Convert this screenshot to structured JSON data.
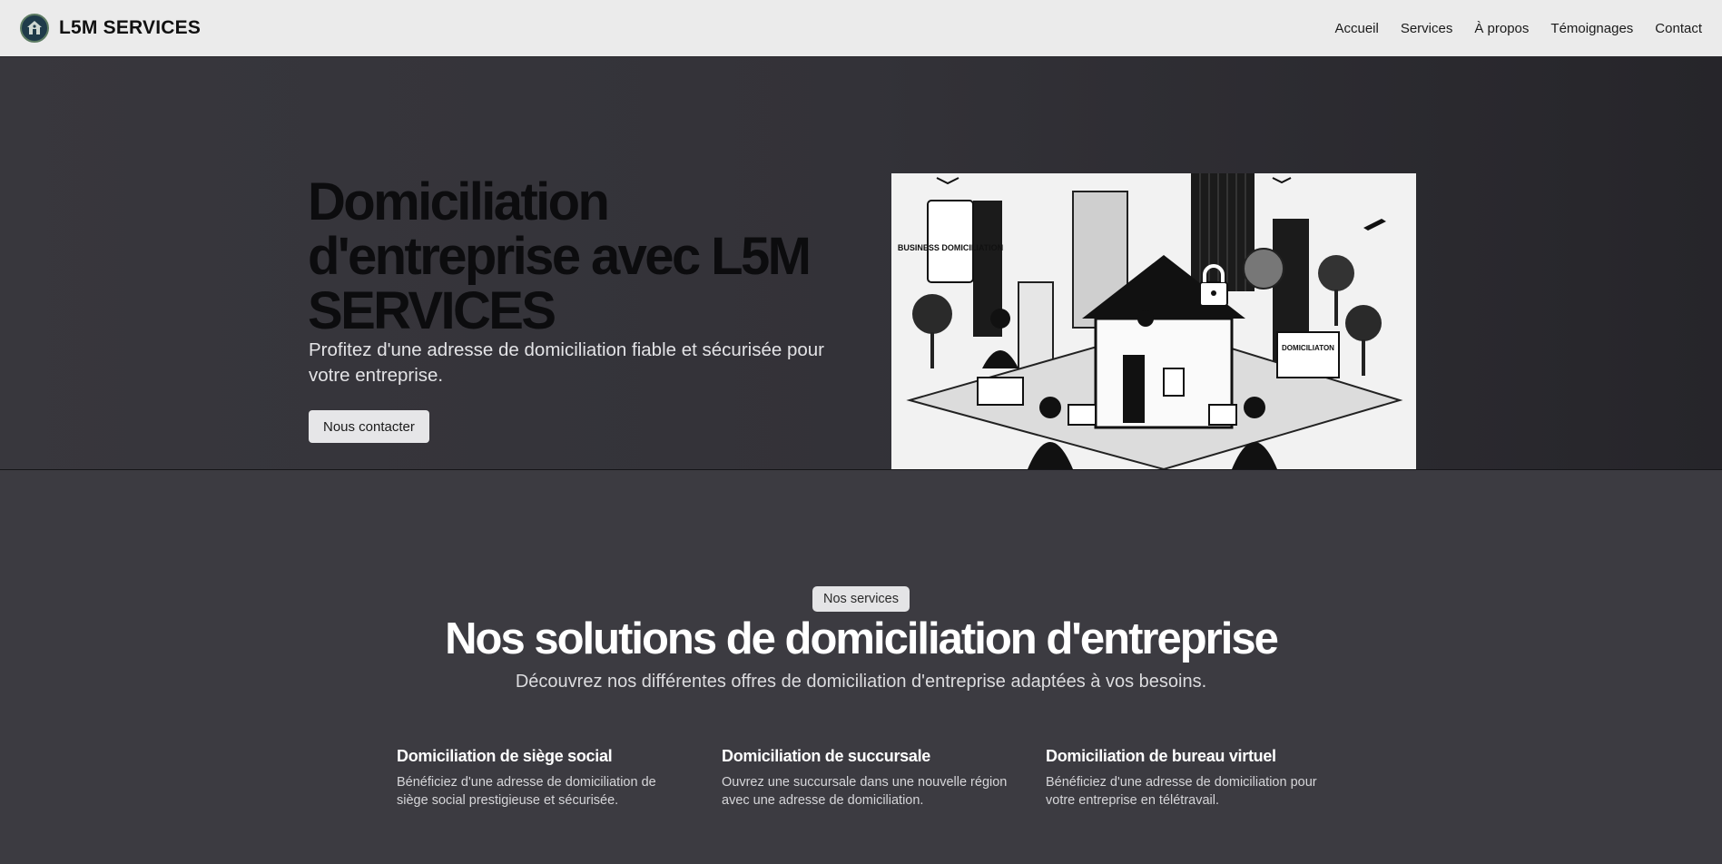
{
  "header": {
    "brand": "L5M SERVICES",
    "logo_icon": "house-shield-logo-icon",
    "nav": [
      "Accueil",
      "Services",
      "À propos",
      "Témoignages",
      "Contact"
    ]
  },
  "hero": {
    "title": "Domiciliation d'entreprise avec L5M SERVICES",
    "subtitle": "Profitez d'une adresse de domiciliation fiable et sécurisée pour votre entreprise.",
    "cta": "Nous contacter",
    "image_icon": "business-domiciliation-illustration",
    "image_signs": [
      "BUSINESS DOMICILIATION",
      "DOMICILIATON"
    ]
  },
  "services": {
    "tag": "Nos services",
    "title": "Nos solutions de domiciliation d'entreprise",
    "subtitle": "Découvrez nos différentes offres de domiciliation d'entreprise adaptées à vos besoins.",
    "cards": [
      {
        "title": "Domiciliation de siège social",
        "text": "Bénéficiez d'une adresse de domiciliation de siège social prestigieuse et sécurisée."
      },
      {
        "title": "Domiciliation de succursale",
        "text": "Ouvrez une succursale dans une nouvelle région avec une adresse de domiciliation."
      },
      {
        "title": "Domiciliation de bureau virtuel",
        "text": "Bénéficiez d'une adresse de domiciliation pour votre entreprise en télétravail."
      }
    ]
  },
  "colors": {
    "header_bg": "#ebebeb",
    "hero_bg": "#333238",
    "section_bg": "#3c3b41",
    "button_bg": "#e6e6e8"
  }
}
